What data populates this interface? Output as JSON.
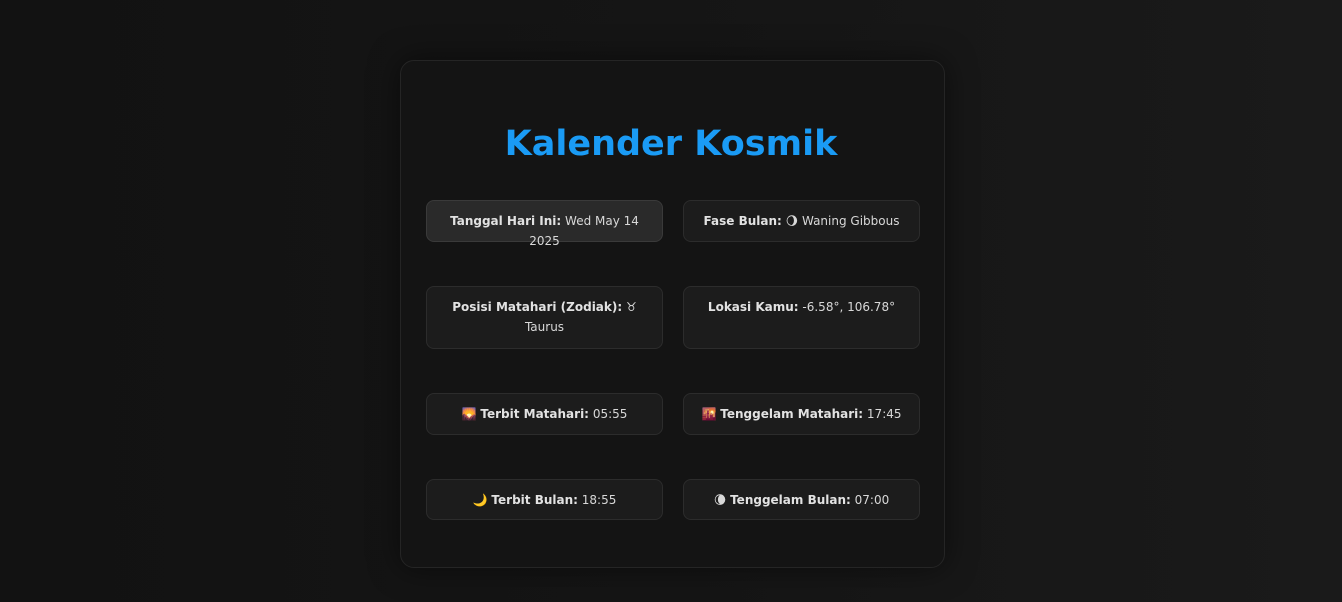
{
  "title": "Kalender Kosmik",
  "items": [
    {
      "icon": "",
      "label": "Tanggal Hari Ini:",
      "value": "Wed May 14 2025"
    },
    {
      "icon": "🌖",
      "label": "Fase Bulan:",
      "value": "Waning Gibbous"
    },
    {
      "icon": "♉",
      "label": "Posisi Matahari (Zodiak):",
      "value": "Taurus"
    },
    {
      "icon": "",
      "label": "Lokasi Kamu:",
      "value": "-6.58°, 106.78°"
    },
    {
      "icon": "🌄",
      "label": "Terbit Matahari:",
      "value": "05:55"
    },
    {
      "icon": "🌇",
      "label": "Tenggelam Matahari:",
      "value": "17:45"
    },
    {
      "icon": "🌙",
      "label": "Terbit Bulan:",
      "value": "18:55"
    },
    {
      "icon": "🌘",
      "label": "Tenggelam Bulan:",
      "value": "07:00"
    }
  ]
}
